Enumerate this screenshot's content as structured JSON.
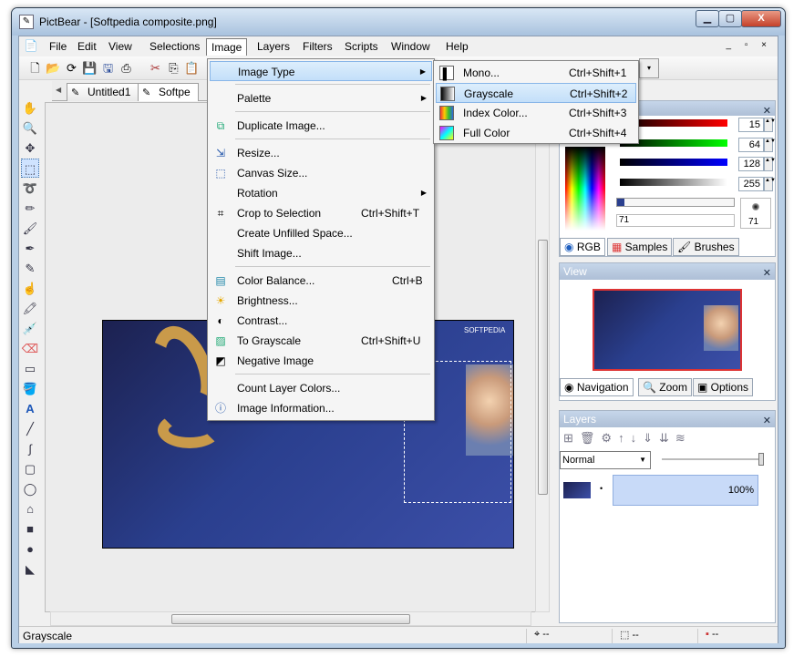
{
  "window": {
    "title": "PictBear - [Softpedia composite.png]",
    "controls": {
      "minimize": "▁",
      "maximize": "▢",
      "close": "X"
    }
  },
  "menubar": {
    "items": [
      "File",
      "Edit",
      "View",
      "Selections",
      "Image",
      "Layers",
      "Filters",
      "Scripts",
      "Window",
      "Help"
    ],
    "active": "Image",
    "mdi_controls": "_ ▫ ×"
  },
  "tabs": [
    "Untitled1",
    "Softpe"
  ],
  "image_menu": {
    "items": [
      {
        "label": "Image Type",
        "shortcut": "",
        "submenu": true,
        "icon": ""
      },
      {
        "label": "Palette",
        "shortcut": "",
        "submenu": true,
        "icon": ""
      },
      {
        "label": "Duplicate Image...",
        "shortcut": "",
        "icon": "duplicate-icon"
      },
      {
        "label": "Resize...",
        "shortcut": "",
        "icon": "resize-icon"
      },
      {
        "label": "Canvas Size...",
        "shortcut": "",
        "icon": "canvas-icon"
      },
      {
        "label": "Rotation",
        "shortcut": "",
        "submenu": true,
        "icon": ""
      },
      {
        "label": "Crop to Selection",
        "shortcut": "Ctrl+Shift+T",
        "icon": "crop-icon"
      },
      {
        "label": "Create Unfilled Space...",
        "shortcut": "",
        "icon": ""
      },
      {
        "label": "Shift Image...",
        "shortcut": "",
        "icon": ""
      },
      {
        "label": "Color Balance...",
        "shortcut": "Ctrl+B",
        "icon": "color-balance-icon"
      },
      {
        "label": "Brightness...",
        "shortcut": "",
        "icon": "sun-icon"
      },
      {
        "label": "Contrast...",
        "shortcut": "",
        "icon": "contrast-icon"
      },
      {
        "label": "To Grayscale",
        "shortcut": "Ctrl+Shift+U",
        "icon": "grayscale-icon"
      },
      {
        "label": "Negative Image",
        "shortcut": "",
        "icon": "negative-icon"
      },
      {
        "label": "Count Layer Colors...",
        "shortcut": "",
        "icon": ""
      },
      {
        "label": "Image Information...",
        "shortcut": "",
        "icon": "info-icon"
      }
    ]
  },
  "image_type_submenu": {
    "items": [
      {
        "label": "Mono...",
        "shortcut": "Ctrl+Shift+1"
      },
      {
        "label": "Grayscale",
        "shortcut": "Ctrl+Shift+2"
      },
      {
        "label": "Index Color...",
        "shortcut": "Ctrl+Shift+3"
      },
      {
        "label": "Full Color",
        "shortcut": "Ctrl+Shift+4"
      }
    ],
    "highlighted": "Grayscale"
  },
  "color_panel": {
    "rgb": [
      "15",
      "64",
      "128"
    ],
    "alpha": "255",
    "slider_left": "71",
    "brush_size": "71",
    "tabs": [
      "RGB",
      "Samples",
      "Brushes"
    ]
  },
  "view_panel": {
    "title": "View",
    "tabs": [
      "Navigation",
      "Zoom",
      "Options"
    ]
  },
  "layers_panel": {
    "title": "Layers",
    "blend_mode": "Normal",
    "layer_opacity": "100%"
  },
  "statusbar": {
    "text": "Grayscale",
    "fields": [
      "--",
      "--",
      "--"
    ]
  },
  "image_watermark": "SOFTPEDIA",
  "colors": {
    "accent": "#3399ff",
    "highlight": "#c3dff9",
    "image_blue": "#2a3f8e"
  }
}
